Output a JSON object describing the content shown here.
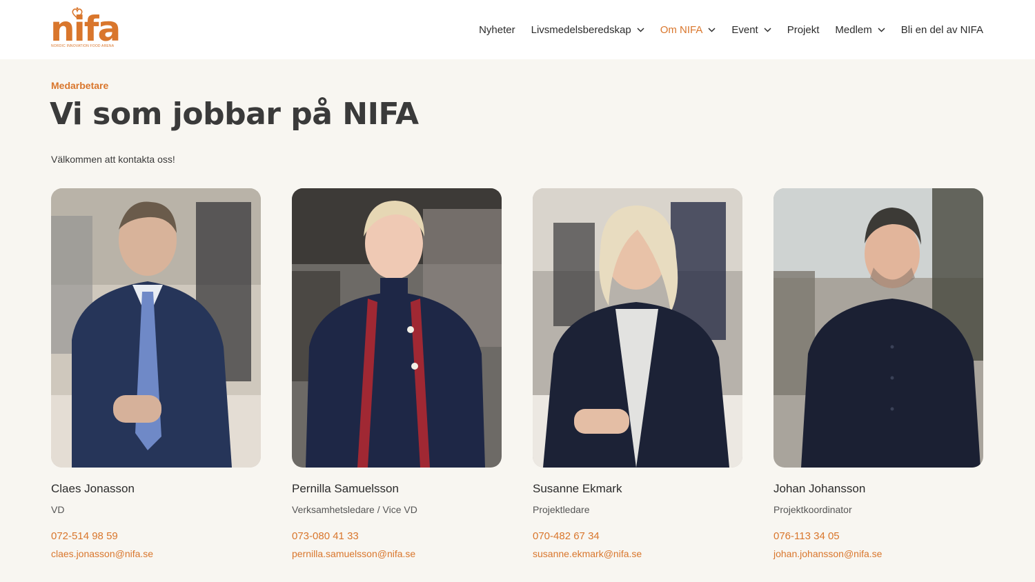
{
  "brand": {
    "name": "nifa",
    "tagline": "NORDIC INNOVATION FOOD ARENA",
    "color": "#d9762c"
  },
  "nav": {
    "items": [
      {
        "label": "Nyheter",
        "dropdown": false,
        "active": false
      },
      {
        "label": "Livsmedelsberedskap",
        "dropdown": true,
        "active": false
      },
      {
        "label": "Om NIFA",
        "dropdown": true,
        "active": true
      },
      {
        "label": "Event",
        "dropdown": true,
        "active": false
      },
      {
        "label": "Projekt",
        "dropdown": false,
        "active": false
      },
      {
        "label": "Medlem",
        "dropdown": true,
        "active": false
      },
      {
        "label": "Bli en del av NIFA",
        "dropdown": false,
        "active": false
      }
    ]
  },
  "page": {
    "eyebrow": "Medarbetare",
    "title": "Vi som jobbar på NIFA",
    "intro": "Välkommen att kontakta oss!"
  },
  "staff": [
    {
      "name": "Claes Jonasson",
      "role": "VD",
      "phone": "072-514 98 59",
      "email": "claes.jonasson@nifa.se"
    },
    {
      "name": "Pernilla Samuelsson",
      "role": "Verksamhetsledare / Vice VD",
      "phone": "073-080 41 33",
      "email": "pernilla.samuelsson@nifa.se"
    },
    {
      "name": "Susanne Ekmark",
      "role": "Projektledare",
      "phone": "070-482 67 34",
      "email": "susanne.ekmark@nifa.se"
    },
    {
      "name": "Johan Johansson",
      "role": "Projektkoordinator",
      "phone": "076-113 34 05",
      "email": "johan.johansson@nifa.se"
    }
  ]
}
